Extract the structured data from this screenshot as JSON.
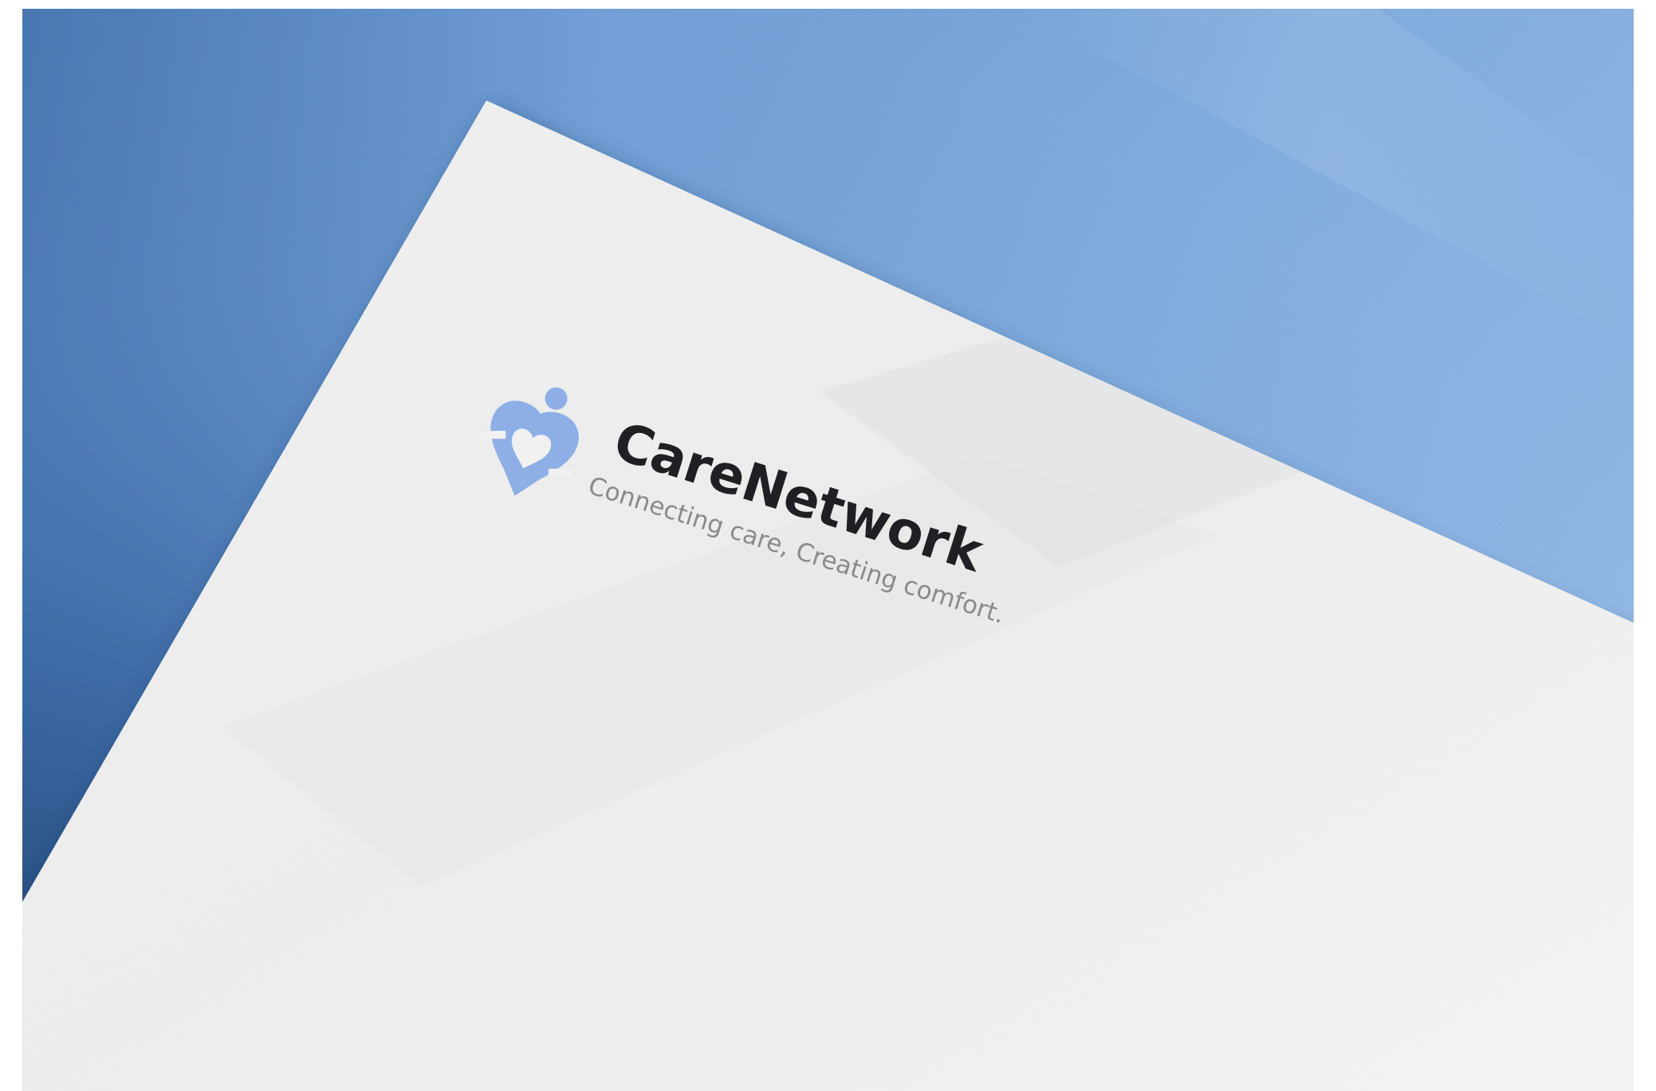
{
  "brand": {
    "name": "CareNetwork",
    "tagline": "Connecting care, Creating comfort."
  },
  "logo": {
    "icon": "person-heart-icon",
    "color": "#8eaee6"
  },
  "colors": {
    "backdrop": "#7aa9e0",
    "paper": "#f1f1f1",
    "wordmark": "#1f2024",
    "tagline": "#8a8a8e"
  }
}
